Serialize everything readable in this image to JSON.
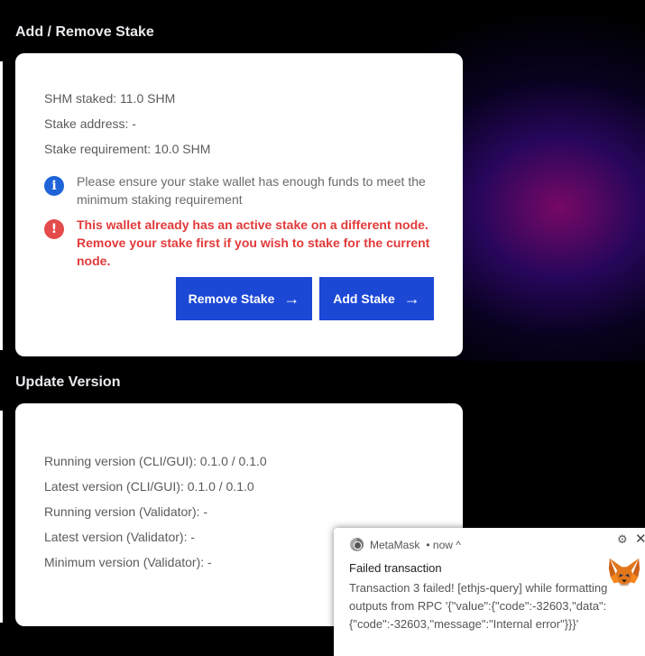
{
  "stake_section": {
    "title": "Add / Remove Stake",
    "shm_staked": "SHM staked: 11.0 SHM",
    "stake_address": "Stake address: -",
    "stake_requirement": "Stake requirement: 10.0 SHM",
    "info_notice": "Please ensure your stake wallet has enough funds to meet the minimum staking requirement",
    "error_notice": "This wallet already has an active stake on a different node. Remove your stake first if you wish to stake for the current node.",
    "remove_button": "Remove Stake",
    "add_button": "Add Stake",
    "info_icon": "i",
    "error_icon": "!",
    "arrow_icon": "→"
  },
  "version_section": {
    "title": "Update Version",
    "running_cli_gui": "Running version (CLI/GUI): 0.1.0 / 0.1.0",
    "latest_cli_gui": "Latest version (CLI/GUI): 0.1.0 / 0.1.0",
    "running_validator": "Running version (Validator): -",
    "latest_validator": "Latest version (Validator): -",
    "minimum_validator": "Minimum version (Validator): -"
  },
  "notification": {
    "app": "MetaMask",
    "time": "• now ^",
    "title": "Failed transaction",
    "message": "Transaction 3 failed! [ethjs-query] while formatting outputs from RPC '{\"value\":{\"code\":-32603,\"data\":{\"code\":-32603,\"message\":\"Internal error\"}}}'",
    "gear_icon": "⚙",
    "close_icon": "✕"
  },
  "colors": {
    "primary_button": "#1c48d6",
    "error": "#e23a3a",
    "info": "#1e63d8"
  }
}
